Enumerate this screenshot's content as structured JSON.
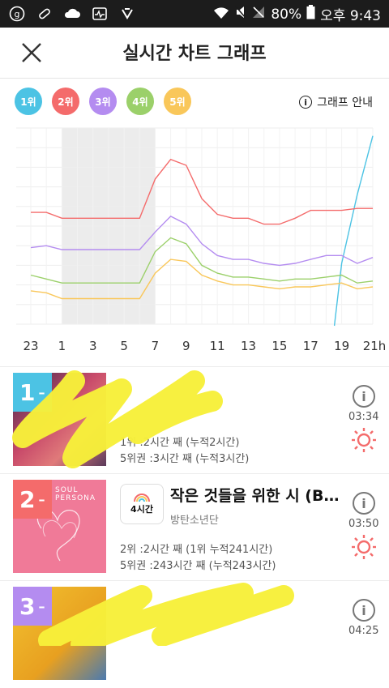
{
  "status_bar": {
    "battery": "80%",
    "time": "오후 9:43"
  },
  "header": {
    "title": "실시간 차트 그래프"
  },
  "legend": {
    "items": [
      {
        "label": "1위",
        "color": "#4cc3e4"
      },
      {
        "label": "2위",
        "color": "#f46b6b"
      },
      {
        "label": "3위",
        "color": "#b48cf0"
      },
      {
        "label": "4위",
        "color": "#9bd06a"
      },
      {
        "label": "5위",
        "color": "#f9c75a"
      }
    ],
    "guide_label": "그래프 안내"
  },
  "chart_data": {
    "type": "line",
    "x": [
      "23",
      "0",
      "1",
      "2",
      "3",
      "4",
      "5",
      "6",
      "7",
      "8",
      "9",
      "10",
      "11",
      "12",
      "13",
      "14",
      "15",
      "16",
      "17",
      "18",
      "19",
      "20",
      "21"
    ],
    "x_tick_labels": [
      "23",
      "1",
      "3",
      "5",
      "7",
      "9",
      "11",
      "13",
      "15",
      "17",
      "19",
      "21h"
    ],
    "ylim": [
      0,
      10
    ],
    "grid": true,
    "shaded_range": [
      "1",
      "7"
    ],
    "series": [
      {
        "name": "1위",
        "color": "#4cc3e4",
        "values": [
          null,
          null,
          null,
          null,
          null,
          null,
          null,
          null,
          null,
          null,
          null,
          null,
          null,
          null,
          null,
          null,
          null,
          null,
          null,
          null,
          3.1,
          6.6,
          9.6
        ]
      },
      {
        "name": "2위",
        "color": "#f46b6b",
        "values": [
          5.7,
          5.7,
          5.4,
          5.4,
          5.4,
          5.4,
          5.4,
          5.4,
          7.4,
          8.4,
          8.1,
          6.4,
          5.6,
          5.4,
          5.4,
          5.1,
          5.1,
          5.4,
          5.8,
          5.8,
          5.8,
          5.9,
          5.9
        ]
      },
      {
        "name": "3위",
        "color": "#b48cf0",
        "values": [
          3.9,
          4.0,
          3.8,
          3.8,
          3.8,
          3.8,
          3.8,
          3.8,
          4.7,
          5.5,
          5.1,
          4.1,
          3.5,
          3.3,
          3.3,
          3.1,
          3.0,
          3.1,
          3.3,
          3.5,
          3.5,
          3.1,
          3.4
        ]
      },
      {
        "name": "4위",
        "color": "#9bd06a",
        "values": [
          2.5,
          2.3,
          2.1,
          2.1,
          2.1,
          2.1,
          2.1,
          2.1,
          3.7,
          4.4,
          4.1,
          3.0,
          2.6,
          2.4,
          2.4,
          2.3,
          2.2,
          2.3,
          2.3,
          2.4,
          2.5,
          2.1,
          2.2
        ]
      },
      {
        "name": "5위",
        "color": "#f9c75a",
        "values": [
          1.7,
          1.6,
          1.3,
          1.3,
          1.3,
          1.3,
          1.3,
          1.3,
          2.6,
          3.3,
          3.2,
          2.5,
          2.2,
          2.0,
          2.0,
          1.9,
          1.8,
          1.9,
          1.9,
          2.0,
          2.1,
          1.8,
          1.9
        ]
      }
    ]
  },
  "list": {
    "rows": [
      {
        "rank": "1",
        "movement": "–",
        "badge_color": "#4cc3e4",
        "stat1": "1위 :2시간 째 (누적2시간)",
        "stat2": "5위권 :3시간 째 (누적3시간)",
        "time": "03:34"
      },
      {
        "rank": "2",
        "movement": "–",
        "badge_color": "#f46b6b",
        "album_text": "SOUL PERSONA",
        "tag": "4시간",
        "title": "작은 것들을 위한 시 (Boy With Luv)",
        "artist": "방탄소년단",
        "stat1": "2위 :2시간 째 (1위 누적241시간)",
        "stat2": "5위권 :243시간 째 (누적243시간)",
        "time": "03:50"
      },
      {
        "rank": "3",
        "movement": "–",
        "badge_color": "#b48cf0",
        "time": "04:25"
      }
    ]
  }
}
